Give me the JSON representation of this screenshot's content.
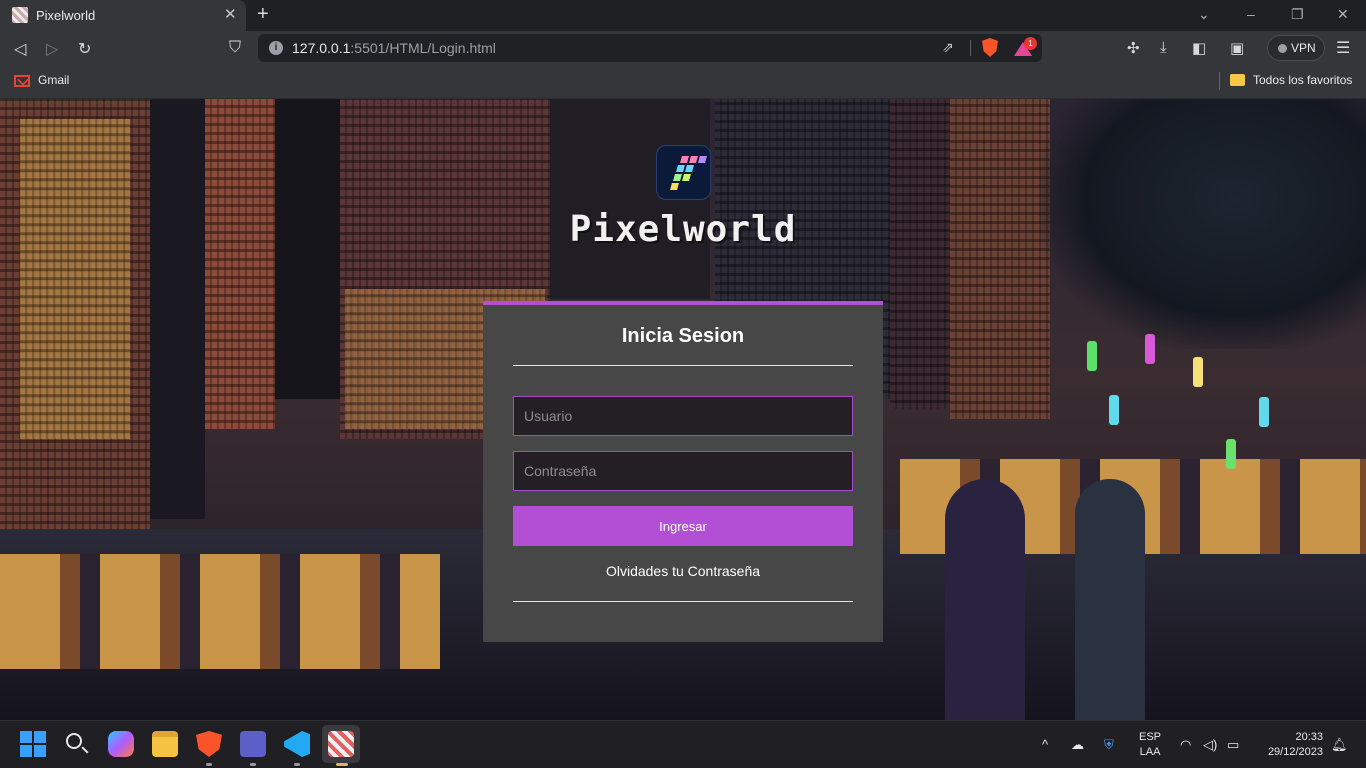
{
  "browser": {
    "tab": {
      "title": "Pixelworld",
      "close": "✕"
    },
    "new_tab": "+",
    "window_controls": {
      "minimize": "–",
      "restore": "❐",
      "close": "✕",
      "expand": "⌄"
    },
    "nav": {
      "back": "◁",
      "forward": "▷",
      "reload": "↻",
      "bookmark": "⛉"
    },
    "address": {
      "host": "127.0.0.1",
      "path": ":5501/HTML/Login.html",
      "info_icon": "i"
    },
    "rewards_badge": "1",
    "vpn_label": "VPN",
    "menu": "☰",
    "bookmarks": {
      "gmail": "Gmail",
      "all_favorites": "Todos los favoritos"
    },
    "colors": {
      "brave_orange": "#fb542b",
      "rewards_pink": "#e0489c"
    }
  },
  "page": {
    "brand": "Pixelworld",
    "login": {
      "title": "Inicia Sesion",
      "username_placeholder": "Usuario",
      "password_placeholder": "Contraseña",
      "submit_label": "Ingresar",
      "forgot_label": "Olvidades tu Contraseña"
    },
    "colors": {
      "accent": "#b24fd4",
      "card": "#474747",
      "input_bg": "#231f24"
    }
  },
  "taskbar": {
    "language": {
      "code": "ESP",
      "layout": "LAA"
    },
    "time": "20:33",
    "date": "29/12/2023",
    "tray_chevron": "^",
    "apps": [
      "start-icon",
      "search-icon",
      "copilot-icon",
      "file-explorer-icon",
      "brave-icon",
      "teams-icon",
      "vscode-icon",
      "paint-icon"
    ]
  }
}
